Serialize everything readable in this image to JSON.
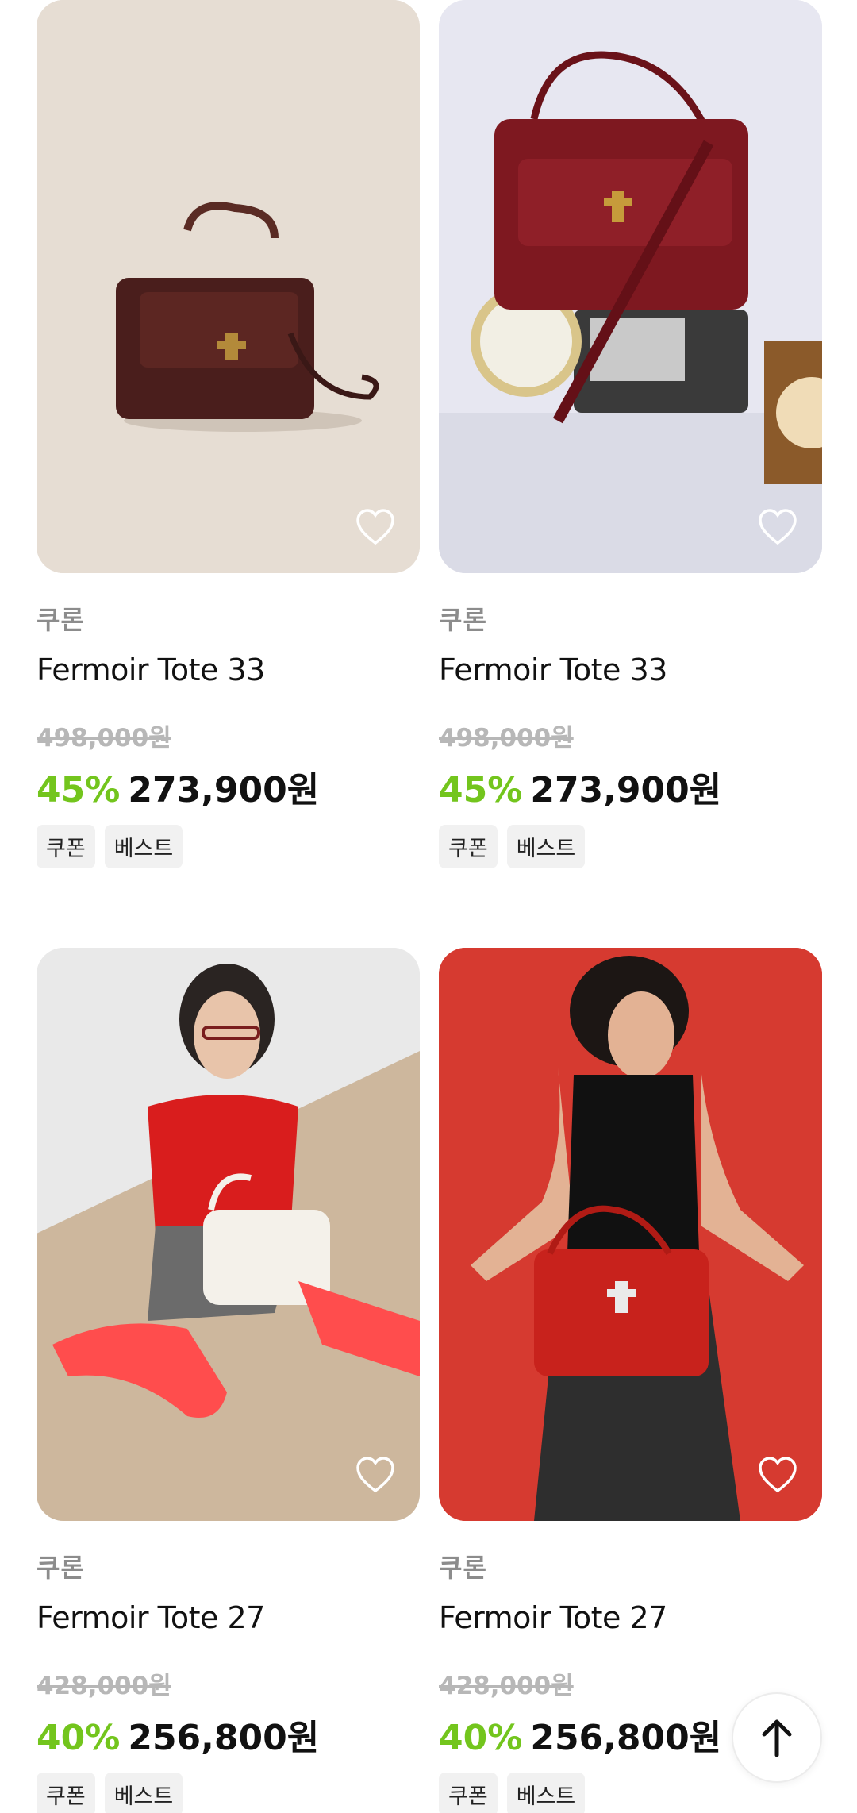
{
  "products": [
    {
      "brand": "쿠론",
      "name": "Fermoir Tote 33",
      "original_price": "498,000원",
      "discount": "45%",
      "price": "273,900원",
      "badges": [
        "쿠폰",
        "베스트"
      ],
      "image_bg": "#e6ddd3"
    },
    {
      "brand": "쿠론",
      "name": "Fermoir Tote 33",
      "original_price": "498,000원",
      "discount": "45%",
      "price": "273,900원",
      "badges": [
        "쿠폰",
        "베스트"
      ],
      "image_bg": "#e7e7f1"
    },
    {
      "brand": "쿠론",
      "name": "Fermoir Tote 27",
      "original_price": "428,000원",
      "discount": "40%",
      "price": "256,800원",
      "badges": [
        "쿠폰",
        "베스트"
      ],
      "image_bg": "#e9e9e9"
    },
    {
      "brand": "쿠론",
      "name": "Fermoir Tote 27",
      "original_price": "428,000원",
      "discount": "40%",
      "price": "256,800원",
      "badges": [
        "쿠폰",
        "베스트"
      ],
      "image_bg": "#d63a30"
    }
  ],
  "colors": {
    "discount": "#73c51d",
    "strike": "#b7b7b7",
    "brand": "#8c8c8c"
  },
  "icons": {
    "wishlist": "heart-outline-icon",
    "scroll_top": "arrow-up-icon"
  }
}
